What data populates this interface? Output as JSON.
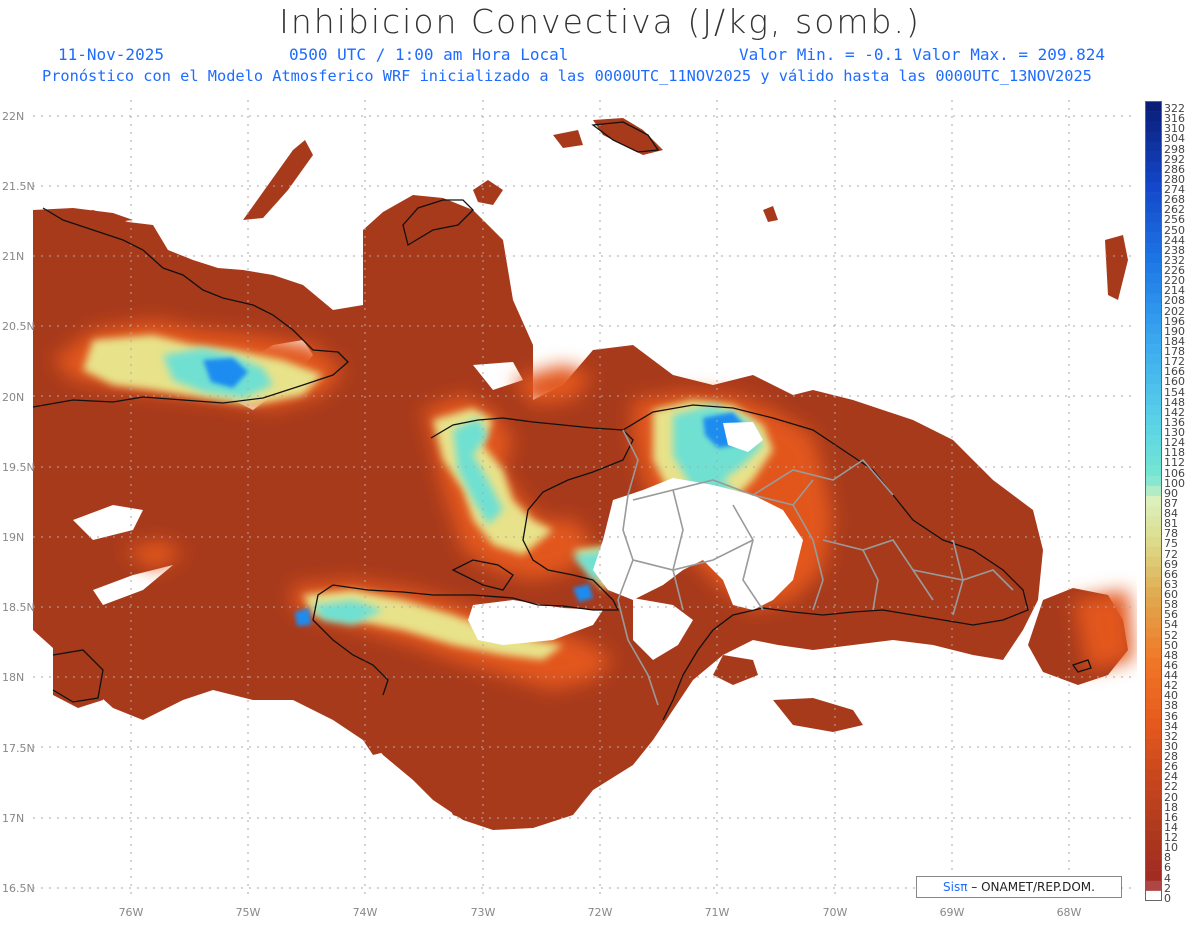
{
  "header": {
    "title": "Inhibicion Convectiva (J/kg, somb.)",
    "date": "11-Nov-2025",
    "time": "0500 UTC / 1:00 am Hora Local",
    "minmax": "Valor Min. = -0.1  Valor Max. = 209.824",
    "forecast": "Pronóstico con el Modelo Atmosferico WRF inicializado a las 0000UTC_11NOV2025 y válido hasta las  0000UTC_13NOV2025"
  },
  "y_axis": [
    "22N",
    "21.5N",
    "21N",
    "20.5N",
    "20N",
    "19.5N",
    "19N",
    "18.5N",
    "18N",
    "17.5N",
    "17N",
    "16.5N"
  ],
  "x_axis": [
    "76W",
    "75W",
    "74W",
    "73W",
    "72W",
    "71W",
    "70W",
    "69W",
    "68W"
  ],
  "colorbar_levels": [
    "322",
    "316",
    "310",
    "304",
    "298",
    "292",
    "286",
    "280",
    "274",
    "268",
    "262",
    "256",
    "250",
    "244",
    "238",
    "232",
    "226",
    "220",
    "214",
    "208",
    "202",
    "196",
    "190",
    "184",
    "178",
    "172",
    "166",
    "160",
    "154",
    "148",
    "142",
    "136",
    "130",
    "124",
    "118",
    "112",
    "106",
    "100",
    "90",
    "87",
    "84",
    "81",
    "78",
    "75",
    "72",
    "69",
    "66",
    "63",
    "60",
    "58",
    "56",
    "54",
    "52",
    "50",
    "48",
    "46",
    "44",
    "42",
    "40",
    "38",
    "36",
    "34",
    "32",
    "30",
    "28",
    "26",
    "24",
    "22",
    "20",
    "18",
    "16",
    "14",
    "12",
    "10",
    "8",
    "6",
    "4",
    "2",
    "0"
  ],
  "credit": {
    "sis": "Sisπ",
    "text": " – ONAMET/REP.DOM."
  },
  "colors": {
    "base": "#a83a1c",
    "mid": "#e2561c",
    "bright": "#f07a1c",
    "yellow": "#e8e28a",
    "cyan": "#6fe0d2",
    "blue": "#1e8cf0",
    "text_blue": "#1e6cff"
  }
}
